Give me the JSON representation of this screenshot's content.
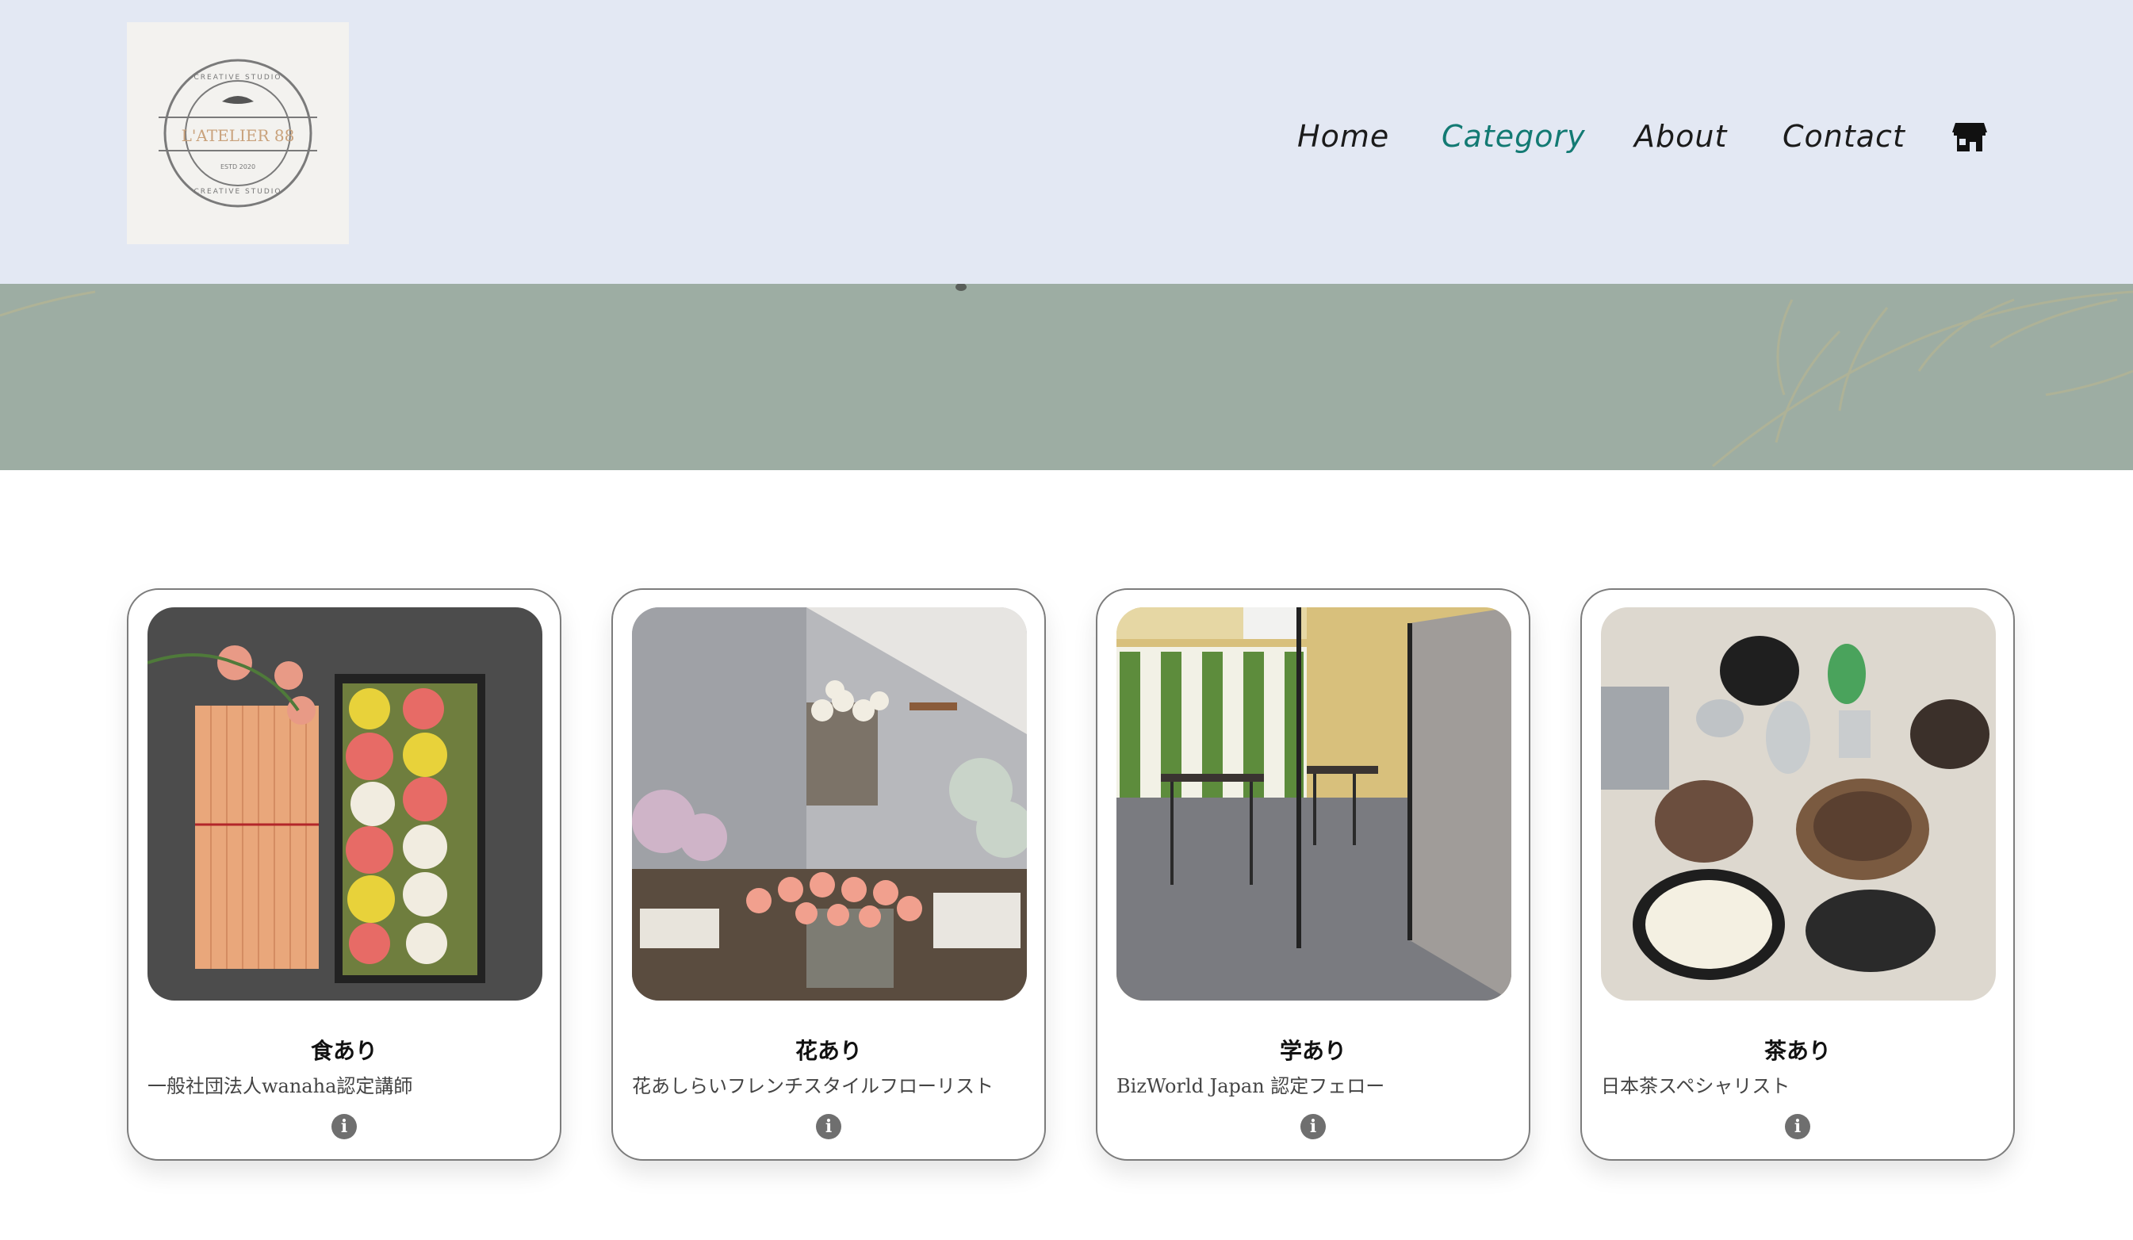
{
  "logo": {
    "text": "L'ATELIER 88",
    "arc_top": "CREATIVE STUDIO",
    "arc_bottom": "CREATIVE STUDIO",
    "small": "ESTD 2020"
  },
  "nav": {
    "items": [
      {
        "label": "Home",
        "active": false
      },
      {
        "label": "Category",
        "active": true
      },
      {
        "label": "About",
        "active": false
      },
      {
        "label": "Contact",
        "active": false
      }
    ],
    "shop_icon": "storefront-icon"
  },
  "colors": {
    "header_bg": "#e3e8f3",
    "banner_bg": "#9dada3",
    "accent": "#137a73"
  },
  "cards": [
    {
      "title": "食あり",
      "subtitle": "一般社団法人wanaha認定講師",
      "image": "flower-shaped sweets in a black box",
      "icon": "info-icon"
    },
    {
      "title": "花あり",
      "subtitle": "花あしらいフレンチスタイルフローリスト",
      "image": "flower shop display",
      "icon": "info-icon"
    },
    {
      "title": "学あり",
      "subtitle": "BizWorld Japan 認定フェロー",
      "image": "meeting room",
      "icon": "info-icon"
    },
    {
      "title": "茶あり",
      "subtitle": "日本茶スペシャリスト",
      "image": "tea utensils",
      "icon": "info-icon"
    }
  ]
}
